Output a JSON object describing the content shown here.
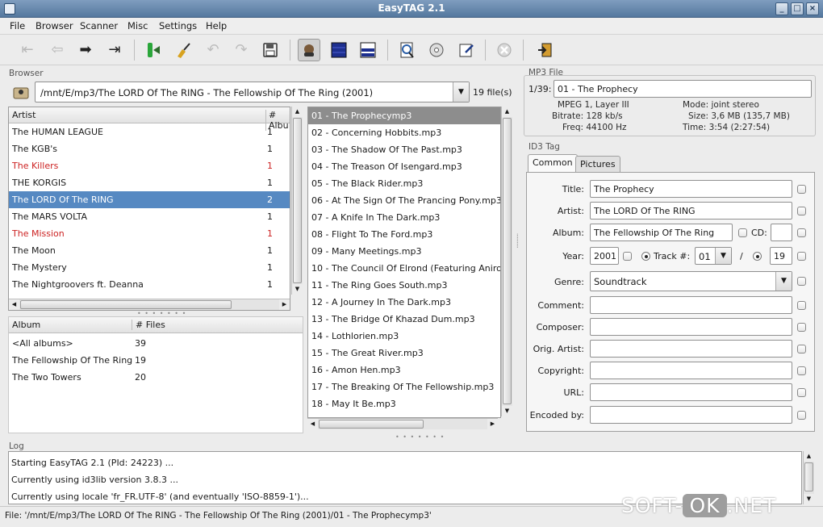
{
  "window": {
    "title": "EasyTAG 2.1"
  },
  "menu": [
    "File",
    "Browser",
    "Scanner",
    "Misc",
    "Settings",
    "Help"
  ],
  "toolbar_icons": [
    "first-icon",
    "previous-icon",
    "next-icon",
    "last-icon",
    "scan-icon",
    "broom-icon",
    "undo-icon",
    "redo-icon",
    "save-icon",
    "browse-subdir-icon",
    "select-all-icon",
    "view-icon",
    "search-icon",
    "cd-icon",
    "playlist-icon",
    "stop-icon",
    "quit-icon"
  ],
  "browser": {
    "label": "Browser",
    "path": "/mnt/E/mp3/The LORD Of The RING - The Fellowship Of The Ring (2001)",
    "file_count": "19 file(s)",
    "artist_list": {
      "headers": [
        "Artist",
        "# Albu"
      ],
      "rows": [
        {
          "artist": "The HUMAN LEAGUE",
          "albums": "1"
        },
        {
          "artist": "The KGB's",
          "albums": "1"
        },
        {
          "artist": "The Killers",
          "albums": "1"
        },
        {
          "artist": "THE KORGIS",
          "albums": "1"
        },
        {
          "artist": "The LORD Of The RING",
          "albums": "2"
        },
        {
          "artist": "The MARS VOLTA",
          "albums": "1"
        },
        {
          "artist": "The Mission",
          "albums": "1"
        },
        {
          "artist": "The Moon",
          "albums": "1"
        },
        {
          "artist": "The Mystery",
          "albums": "1"
        },
        {
          "artist": "The Nightgroovers ft. Deanna",
          "albums": "1"
        }
      ]
    },
    "album_list": {
      "headers": [
        "Album",
        "# Files"
      ],
      "rows": [
        {
          "album": "<All albums>",
          "files": "39"
        },
        {
          "album": "The Fellowship Of The Ring",
          "files": "19"
        },
        {
          "album": "The Two Towers",
          "files": "20"
        }
      ]
    },
    "files": [
      "01 - The Prophecymp3",
      "02 - Concerning Hobbits.mp3",
      "03 - The Shadow Of The Past.mp3",
      "04 - The Treason Of Isengard.mp3",
      "05 - The Black Rider.mp3",
      "06 - At The Sign Of The Prancing Pony.mp3",
      "07 - A Knife In The Dark.mp3",
      "08 - Flight To The Ford.mp3",
      "09 - Many Meetings.mp3",
      "10 - The Council Of Elrond (Featuring Aniron",
      "11 - The Ring Goes South.mp3",
      "12 - A Journey In The Dark.mp3",
      "13 - The Bridge Of Khazad Dum.mp3",
      "14 - Lothlorien.mp3",
      "15 - The Great River.mp3",
      "16 - Amon Hen.mp3",
      "17 - The Breaking Of The Fellowship.mp3",
      "18 - May It Be.mp3"
    ]
  },
  "mp3file": {
    "label": "MP3 File",
    "index": "1/39:",
    "filename": "01 - The Prophecy",
    "info_left": [
      "MPEG 1, Layer III",
      "Bitrate: 128 kb/s",
      "Freq: 44100 Hz"
    ],
    "info_right": [
      "Mode: joint stereo",
      "Size: 3,6 MB (135,7 MB)",
      "Time: 3:54 (2:27:54)"
    ]
  },
  "id3": {
    "label": "ID3 Tag",
    "tabs": [
      "Common",
      "Pictures"
    ],
    "fields": {
      "title_label": "Title:",
      "title": "The Prophecy",
      "artist_label": "Artist:",
      "artist": "The LORD Of The RING",
      "album_label": "Album:",
      "album": "The Fellowship Of The Ring",
      "cd_label": "CD:",
      "cd": "",
      "year_label": "Year:",
      "year": "2001",
      "track_label": "Track #:",
      "track": "01",
      "track_sep": "/",
      "track_total": "19",
      "genre_label": "Genre:",
      "genre": "Soundtrack",
      "comment_label": "Comment:",
      "comment": "",
      "composer_label": "Composer:",
      "composer": "",
      "orig_artist_label": "Orig. Artist:",
      "orig_artist": "",
      "copyright_label": "Copyright:",
      "copyright": "",
      "url_label": "URL:",
      "url": "",
      "encoded_label": "Encoded by:",
      "encoded": ""
    }
  },
  "log": {
    "label": "Log",
    "lines": [
      "Starting EasyTAG 2.1 (PId: 24223) ...",
      "Currently using id3lib version 3.8.3 ...",
      "Currently using locale 'fr_FR.UTF-8' (and eventually 'ISO-8859-1')..."
    ]
  },
  "status": "File: '/mnt/E/mp3/The LORD Of The RING - The Fellowship Of The Ring (2001)/01 - The Prophecymp3'",
  "watermark": {
    "left": "SOFT-",
    "ok": "OK",
    "right": ".NET"
  },
  "colors": {
    "selection": "#5689c2",
    "titlebar": "#54789e",
    "error_text": "#cc2222"
  }
}
